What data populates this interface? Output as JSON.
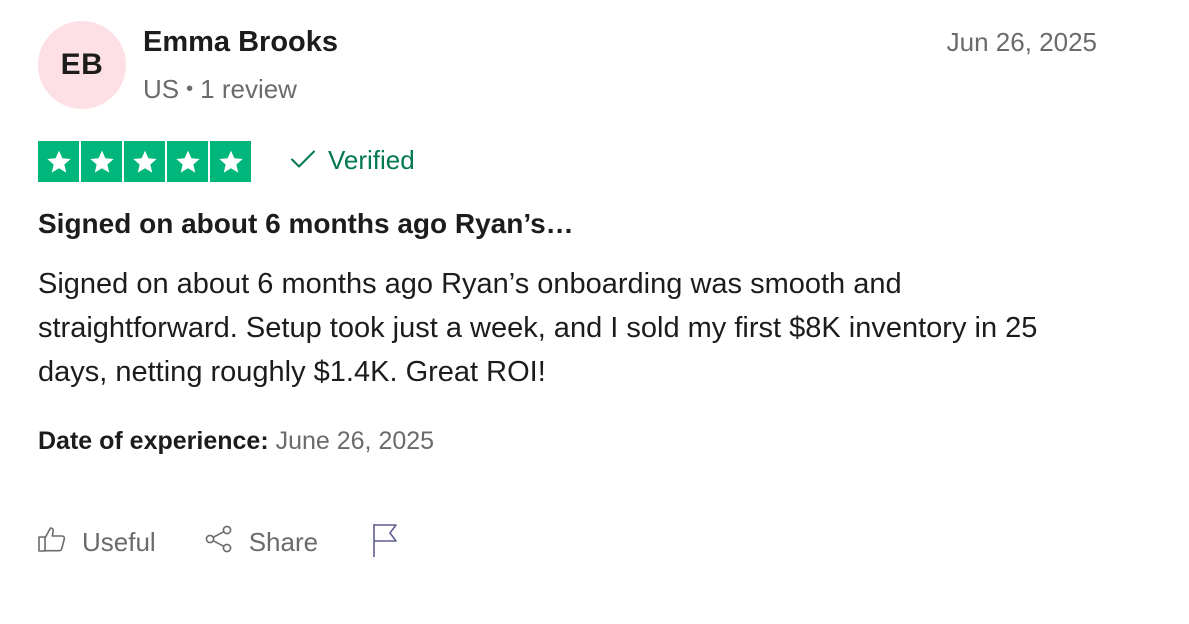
{
  "reviewer": {
    "initials": "EB",
    "name": "Emma Brooks",
    "country": "US",
    "separator": "•",
    "review_count": "1 review",
    "avatar_color": "#fde0e6"
  },
  "review": {
    "date": "Jun 26, 2025",
    "rating": 5,
    "star_color": "#00b67a",
    "verified_label": "Verified",
    "verified_color": "#04794f",
    "title": "Signed on about 6 months ago Ryan’s…",
    "body": "Signed on about 6 months ago Ryan’s onboarding was smooth and straightforward. Setup took just a week, and I sold my first $8K inventory in 25 days, netting roughly $1.4K. Great ROI!",
    "experience_label": "Date of experience:",
    "experience_date": "June 26, 2025"
  },
  "actions": {
    "useful_label": "Useful",
    "useful_icon": "thumbs-up-icon",
    "share_label": "Share",
    "share_icon": "share-icon",
    "report_icon": "flag-icon"
  }
}
